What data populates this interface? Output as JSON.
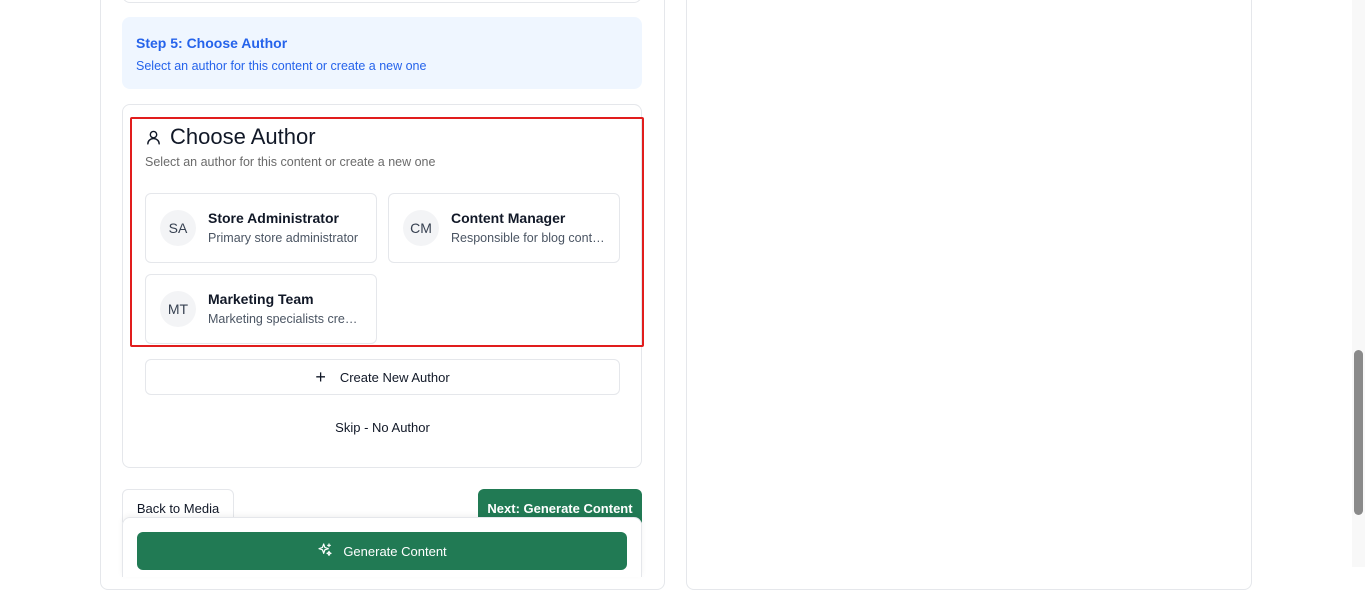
{
  "step": {
    "title": "Step 5: Choose Author",
    "subtitle": "Select an author for this content or create a new one"
  },
  "author_card": {
    "title": "Choose Author",
    "subtitle": "Select an author for this content or create a new one",
    "icon": "user-icon",
    "authors": [
      {
        "initials": "SA",
        "name": "Store Administrator",
        "description": "Primary store administrator"
      },
      {
        "initials": "CM",
        "name": "Content Manager",
        "description": "Responsible for blog content"
      },
      {
        "initials": "MT",
        "name": "Marketing Team",
        "description": "Marketing specialists creating content"
      }
    ],
    "create_label": "Create New Author",
    "skip_label": "Skip - No Author"
  },
  "nav": {
    "back_label": "Back to Media",
    "next_label": "Next: Generate Content"
  },
  "footer": {
    "generate_label": "Generate Content",
    "generate_icon": "sparkles-icon"
  },
  "colors": {
    "accent": "#217a54",
    "step_blue": "#2563eb",
    "highlight": "#e11d1d"
  }
}
